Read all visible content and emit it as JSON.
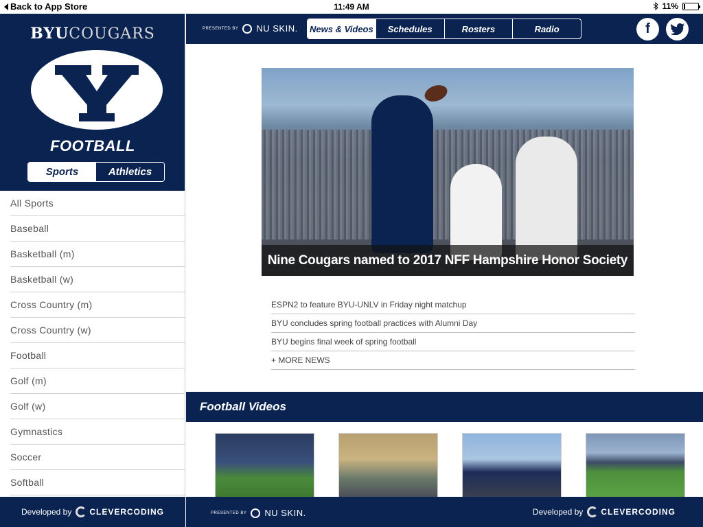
{
  "status": {
    "back_label": "Back to App Store",
    "time": "11:49 AM",
    "battery": "11%",
    "battery_level": 0.11
  },
  "sidebar": {
    "brand_bold": "BYU",
    "brand_light": "COUGARS",
    "sport_title": "FOOTBALL",
    "toggle": [
      "Sports",
      "Athletics"
    ],
    "items": [
      "All Sports",
      "Baseball",
      "Basketball (m)",
      "Basketball (w)",
      "Cross Country (m)",
      "Cross Country (w)",
      "Football",
      "Golf (m)",
      "Golf (w)",
      "Gymnastics",
      "Soccer",
      "Softball"
    ],
    "footer_dev": "Developed by",
    "footer_company": "CLEVERCODING"
  },
  "header": {
    "presented_by": "PRESENTED BY",
    "sponsor": "NU SKIN.",
    "tabs": [
      "News & Videos",
      "Schedules",
      "Rosters",
      "Radio"
    ],
    "facebook": "f",
    "twitter": "t"
  },
  "hero": {
    "caption": "Nine Cougars named to 2017 NFF Hampshire Honor Society"
  },
  "news": [
    "ESPN2 to feature BYU-UNLV in Friday night matchup",
    "BYU concludes spring football practices with Alumni Day",
    "BYU begins final week of spring football",
    "+ MORE NEWS"
  ],
  "videos": {
    "title": "Football Videos"
  },
  "footer": {
    "presented_by": "PRESENTED BY",
    "sponsor": "NU SKIN.",
    "dev": "Developed by",
    "company": "CLEVERCODING"
  },
  "colors": {
    "navy": "#0a2351"
  }
}
